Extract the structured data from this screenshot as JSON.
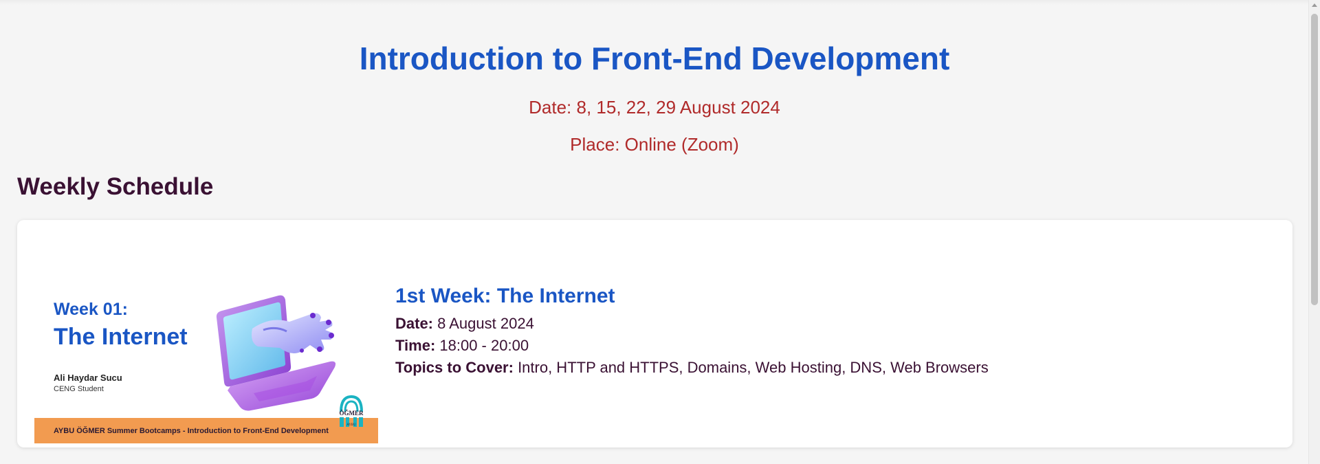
{
  "header": {
    "title": "Introduction to Front-End Development",
    "date": "Date: 8, 15, 22, 29 August 2024",
    "place": "Place: Online (Zoom)"
  },
  "schedule": {
    "heading": "Weekly Schedule",
    "weeks": [
      {
        "banner": {
          "week": "Week 01:",
          "topic": "The Internet",
          "presenter": "Ali Haydar Sucu",
          "role": "CENG Student",
          "footer": "AYBU ÖĞMER Summer Bootcamps - Introduction to Front-End Development",
          "logo_text": "ÖĞMER",
          "logo_subtext": "AYBU"
        },
        "title": "1st Week: The Internet",
        "date_label": "Date:",
        "date_value": " 8 August 2024",
        "time_label": "Time:",
        "time_value": " 18:00 - 20:00",
        "topics_label": "Topics to Cover:",
        "topics_value": " Intro, HTTP and HTTPS, Domains, Web Hosting, DNS, Web Browsers"
      }
    ]
  },
  "icons": {
    "laptop": "laptop-robot-hand-icon",
    "logo": "ogmer-logo-icon"
  },
  "colors": {
    "accent": "#1a56c4",
    "meta": "#b02a2a",
    "text": "#3a1133",
    "banner_footer": "#f29b50"
  }
}
